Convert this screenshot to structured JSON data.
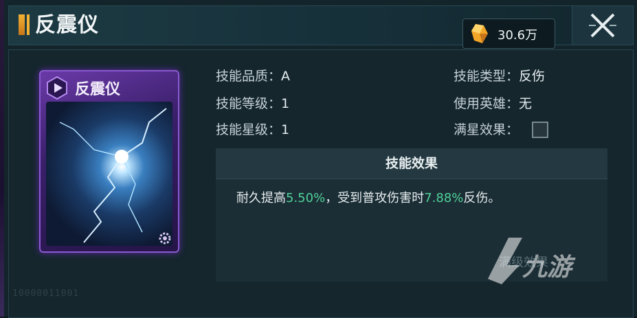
{
  "header": {
    "title": "反震仪",
    "currency_value": "30.6万",
    "currency_icon": "crystal-icon"
  },
  "card": {
    "title": "反震仪",
    "emblem_icon": "play-emblem-icon",
    "corner_icon": "gear-icon"
  },
  "stats": {
    "quality_label": "技能品质：",
    "quality_value": "A",
    "level_label": "技能等级：",
    "level_value": "1",
    "star_label": "技能星级：",
    "star_value": "1",
    "type_label": "技能类型：",
    "type_value": "反伤",
    "hero_label": "使用英雄：",
    "hero_value": "无",
    "fullstar_label": "满星效果："
  },
  "effect": {
    "heading": "技能效果",
    "text_1": "耐久提高",
    "value_1": "5.50%",
    "text_2": "，受到普攻伤害时",
    "value_2": "7.88%",
    "text_3": "反伤。",
    "footer": "满级效果"
  },
  "watermark": {
    "text": "九游"
  },
  "serial": "10000011001",
  "colors": {
    "accent_gold": "#f2b233",
    "highlight_green": "#4fd19a",
    "card_purple": "#6a3aa8"
  }
}
